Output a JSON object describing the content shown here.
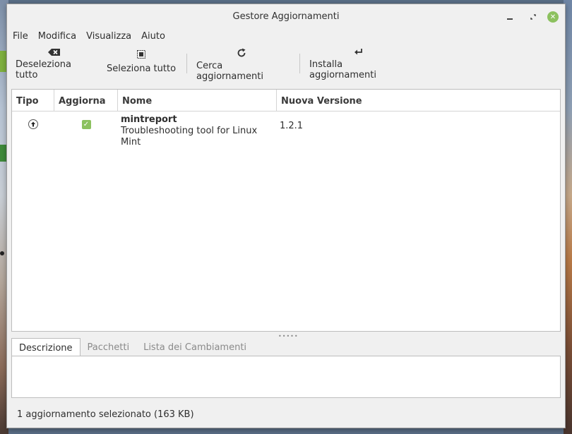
{
  "window": {
    "title": "Gestore Aggiornamenti"
  },
  "menu": [
    "File",
    "Modifica",
    "Visualizza",
    "Aiuto"
  ],
  "toolbar": {
    "deselect_all": "Deseleziona tutto",
    "select_all": "Seleziona tutto",
    "check_updates": "Cerca aggiornamenti",
    "install_updates": "Installa aggiornamenti"
  },
  "table": {
    "columns": [
      "Tipo",
      "Aggiorna",
      "Nome",
      "Nuova Versione"
    ],
    "rows": [
      {
        "type_icon": "upgrade-arrow-icon",
        "checked": true,
        "name": "mintreport",
        "description": "Troubleshooting tool for Linux Mint",
        "version": "1.2.1"
      }
    ]
  },
  "tabs": [
    "Descrizione",
    "Pacchetti",
    "Lista dei Cambiamenti"
  ],
  "status": "1 aggiornamento selezionato (163 KB)",
  "colors": {
    "accent": "#8cc15f"
  }
}
